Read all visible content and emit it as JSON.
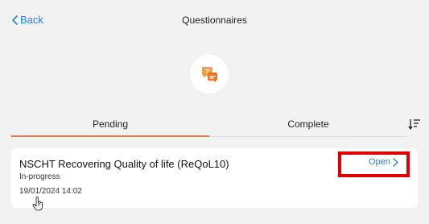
{
  "nav": {
    "back_label": "Back",
    "title": "Questionnaires"
  },
  "hero": {
    "icon": "chat-question-icon",
    "accent": "#f4a13a",
    "accent_dark": "#e8742a"
  },
  "tabs": [
    {
      "label": "Pending",
      "active": true
    },
    {
      "label": "Complete",
      "active": false
    }
  ],
  "sort_icon": "sort-descending-icon",
  "card": {
    "title": "NSCHT Recovering Quality of life (ReQoL10)",
    "status": "In-progress",
    "date": "19/01/2024 14:02",
    "open_label": "Open"
  },
  "colors": {
    "link": "#2a7de1",
    "tab_active": "#e07a4f",
    "highlight": "#e00000",
    "background": "#f2f2f2"
  }
}
